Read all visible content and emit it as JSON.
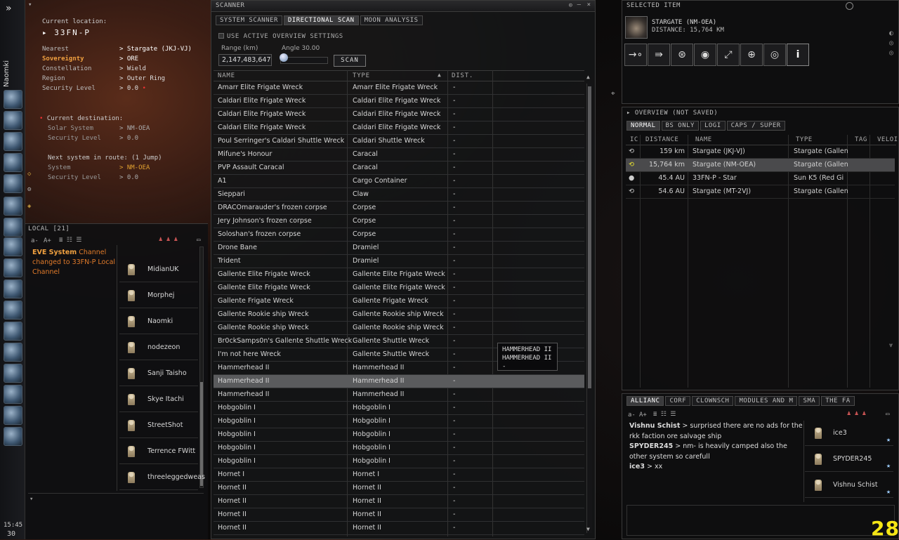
{
  "neocom": {
    "pilot": "Naomki",
    "time": "15:45",
    "count": "30"
  },
  "info": {
    "current_location_label": "Current location:",
    "system": "33FN-P",
    "rows": [
      {
        "label": "Nearest",
        "value": "Stargate (JKJ-VJ)"
      },
      {
        "label": "Sovereignty",
        "value": "ORE"
      },
      {
        "label": "Constellation",
        "value": "Wield"
      },
      {
        "label": "Region",
        "value": "Outer Ring"
      },
      {
        "label": "Security Level",
        "value": "0.0"
      }
    ],
    "dest_label": "Current destination:",
    "dest_rows": [
      {
        "label": "Solar System",
        "value": "NM-OEA"
      },
      {
        "label": "Security Level",
        "value": "0.0"
      }
    ],
    "next_label": "Next system in route:",
    "next_jumps": "(1 Jump)",
    "next_rows": [
      {
        "label": "System",
        "value": "NM-OEA"
      },
      {
        "label": "Security Level",
        "value": "0.0"
      }
    ]
  },
  "local": {
    "title": "LOCAL [21]",
    "font_small": "a-",
    "font_big": "A+",
    "msg_sender": "EVE System",
    "msg_rest": "Channel changed to 33FN-P Local Channel",
    "members": [
      "MidianUK",
      "Morphej",
      "Naomki",
      "nodezeon",
      "Sanji Taisho",
      "Skye Itachi",
      "StreetShot",
      "Terrence FWitt",
      "threeleggedweas"
    ]
  },
  "scanner": {
    "title": "SCANNER",
    "tabs": [
      "SYSTEM SCANNER",
      "DIRECTIONAL SCAN",
      "MOON ANALYSIS"
    ],
    "active_tab": 1,
    "use_overview": "USE ACTIVE OVERVIEW SETTINGS",
    "range_label": "Range (km)",
    "range_value": "2,147,483,647",
    "angle_label": "Angle 30.00",
    "scan_button": "SCAN",
    "col_name": "NAME",
    "col_type": "TYPE",
    "col_dist": "DIST.",
    "rows": [
      {
        "name": "Amarr Elite Frigate Wreck",
        "type": "Amarr Elite Frigate Wreck",
        "dist": "-"
      },
      {
        "name": "Caldari Elite Frigate Wreck",
        "type": "Caldari Elite Frigate Wreck",
        "dist": "-"
      },
      {
        "name": "Caldari Elite Frigate Wreck",
        "type": "Caldari Elite Frigate Wreck",
        "dist": "-"
      },
      {
        "name": "Caldari Elite Frigate Wreck",
        "type": "Caldari Elite Frigate Wreck",
        "dist": "-"
      },
      {
        "name": "Poul Serringer's Caldari Shuttle Wreck",
        "type": "Caldari Shuttle Wreck",
        "dist": "-"
      },
      {
        "name": "Mifune's Honour",
        "type": "Caracal",
        "dist": "-"
      },
      {
        "name": "PVP Assault Caracal",
        "type": "Caracal",
        "dist": "-"
      },
      {
        "name": "A1",
        "type": "Cargo Container",
        "dist": "-"
      },
      {
        "name": "Sieppari",
        "type": "Claw",
        "dist": "-"
      },
      {
        "name": "DRACOmarauder's frozen corpse",
        "type": "Corpse",
        "dist": "-"
      },
      {
        "name": "Jery Johnson's frozen corpse",
        "type": "Corpse",
        "dist": "-"
      },
      {
        "name": "Soloshan's frozen corpse",
        "type": "Corpse",
        "dist": "-"
      },
      {
        "name": "Drone Bane",
        "type": "Dramiel",
        "dist": "-"
      },
      {
        "name": "Trident",
        "type": "Dramiel",
        "dist": "-"
      },
      {
        "name": "Gallente Elite Frigate Wreck",
        "type": "Gallente Elite Frigate Wreck",
        "dist": "-"
      },
      {
        "name": "Gallente Elite Frigate Wreck",
        "type": "Gallente Elite Frigate Wreck",
        "dist": "-"
      },
      {
        "name": "Gallente Frigate Wreck",
        "type": "Gallente Frigate Wreck",
        "dist": "-"
      },
      {
        "name": "Gallente Rookie ship Wreck",
        "type": "Gallente Rookie ship Wreck",
        "dist": "-"
      },
      {
        "name": "Gallente Rookie ship Wreck",
        "type": "Gallente Rookie ship Wreck",
        "dist": "-"
      },
      {
        "name": "Br0ckSamps0n's Gallente Shuttle Wreck",
        "type": "Gallente Shuttle Wreck",
        "dist": "-"
      },
      {
        "name": "I'm not here Wreck",
        "type": "Gallente Shuttle Wreck",
        "dist": "-"
      },
      {
        "name": "Hammerhead II",
        "type": "Hammerhead II",
        "dist": "-"
      },
      {
        "name": "Hammerhead II",
        "type": "Hammerhead II",
        "dist": "-"
      },
      {
        "name": "Hammerhead II",
        "type": "Hammerhead II",
        "dist": "-"
      },
      {
        "name": "Hobgoblin I",
        "type": "Hobgoblin I",
        "dist": "-"
      },
      {
        "name": "Hobgoblin I",
        "type": "Hobgoblin I",
        "dist": "-"
      },
      {
        "name": "Hobgoblin I",
        "type": "Hobgoblin I",
        "dist": "-"
      },
      {
        "name": "Hobgoblin I",
        "type": "Hobgoblin I",
        "dist": "-"
      },
      {
        "name": "Hobgoblin I",
        "type": "Hobgoblin I",
        "dist": "-"
      },
      {
        "name": "Hornet I",
        "type": "Hornet I",
        "dist": "-"
      },
      {
        "name": "Hornet II",
        "type": "Hornet II",
        "dist": "-"
      },
      {
        "name": "Hornet II",
        "type": "Hornet II",
        "dist": "-"
      },
      {
        "name": "Hornet II",
        "type": "Hornet II",
        "dist": "-"
      },
      {
        "name": "Hornet II",
        "type": "Hornet II",
        "dist": "-"
      }
    ],
    "selected_row": 22,
    "tooltip": [
      "HAMMERHEAD II",
      "HAMMERHEAD II",
      "-"
    ]
  },
  "selected_item": {
    "title": "SELECTED ITEM",
    "name": "STARGATE (NM-OEA)",
    "distance": "DISTANCE: 15,764 KM",
    "actions": [
      "approach-icon",
      "warp-icon",
      "jump-icon",
      "orbit-icon",
      "keep-range-icon",
      "target-icon",
      "look-at-icon",
      "info-icon"
    ]
  },
  "overview": {
    "title": "OVERVIEW (NOT SAVED)",
    "tabs": [
      "NORMAL",
      "BS ONLY",
      "LOGI",
      "CAPS / SUPER"
    ],
    "cols": [
      "IC",
      "DISTANCE",
      "NAME",
      "TYPE",
      "TAG",
      "VELOI"
    ],
    "rows": [
      {
        "dist": "159 km",
        "name": "Stargate (JKJ-VJ)",
        "type": "Stargate (Gallen"
      },
      {
        "dist": "15,764 km",
        "name": "Stargate (NM-OEA)",
        "type": "Stargate (Gallen"
      },
      {
        "dist": "45.4 AU",
        "name": "33FN-P - Star",
        "type": "Sun K5 (Red Gi"
      },
      {
        "dist": "54.6 AU",
        "name": "Stargate (MT-2VJ)",
        "type": "Stargate (Gallen"
      }
    ],
    "selected_row": 1
  },
  "chat": {
    "tabs": [
      "ALLIANC",
      "CORF",
      "CLOWNSCH",
      "MODULES AND M",
      "SMA",
      "THE FA"
    ],
    "font_small": "a-",
    "font_big": "A+",
    "messages": [
      {
        "sender": "Vishnu Schist",
        "text": "> surprised there are no ads for the rkk faction ore salvage ship"
      },
      {
        "sender": "SPYDER245",
        "text": "> nm- is heavily camped also the other system so carefull"
      },
      {
        "sender": "ice3",
        "text": "> xx"
      }
    ],
    "members": [
      "ice3",
      "SPYDER245",
      "Vishnu Schist"
    ]
  },
  "fps": "28",
  "colors": {
    "accent_orange": "#e07a2a",
    "sov_orange": "#f0a040",
    "fps_yellow": "#f5e616"
  }
}
